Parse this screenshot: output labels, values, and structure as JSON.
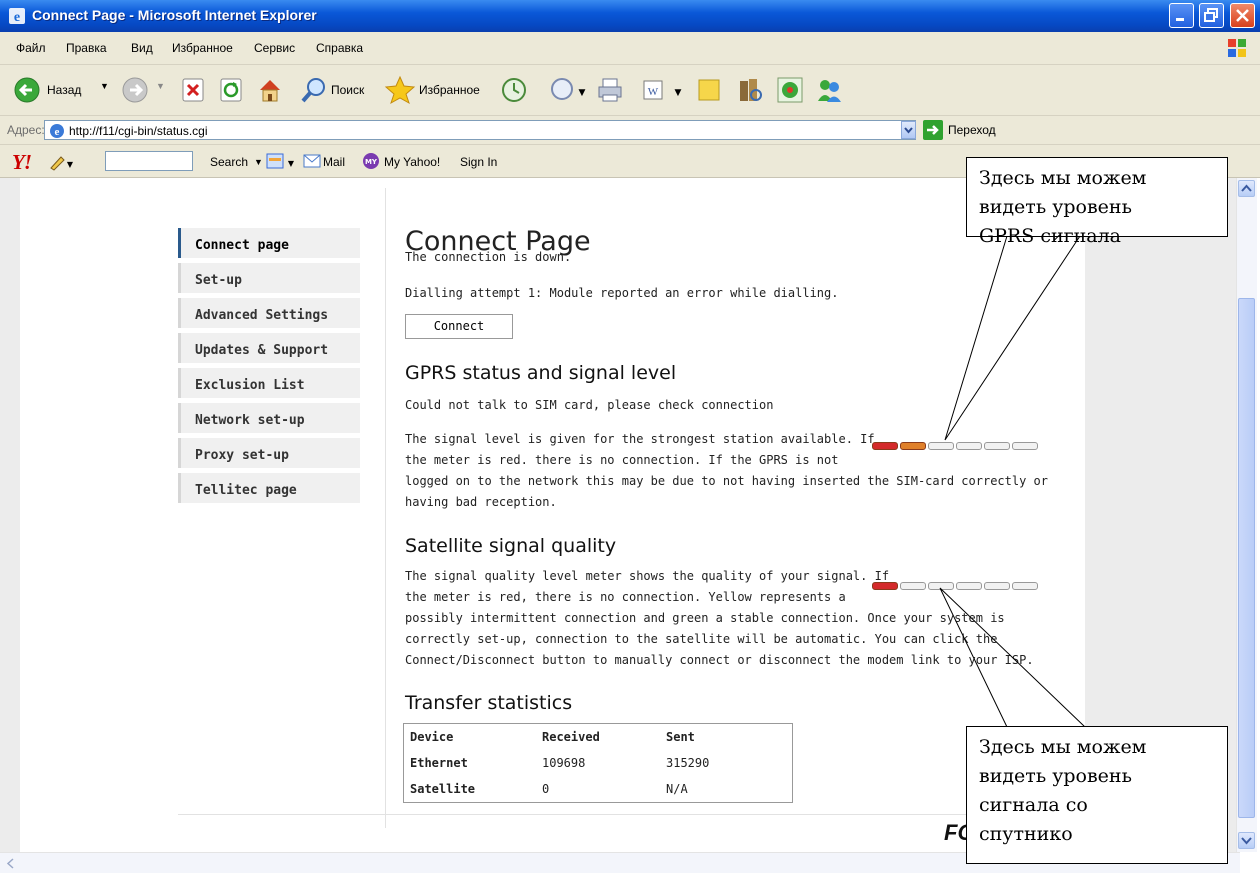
{
  "window": {
    "title": "Connect Page - Microsoft Internet Explorer"
  },
  "menu": [
    "Файл",
    "Правка",
    "Вид",
    "Избранное",
    "Сервис",
    "Справка"
  ],
  "toolbar": {
    "back_label": "Назад",
    "search_label": "Поиск",
    "favorites_label": "Избранное"
  },
  "address": {
    "label": "Адрес:",
    "url": "http://f11/cgi-bin/status.cgi",
    "go_label": "Переход"
  },
  "yahoo": {
    "search_label": "Search",
    "mail_label": "Mail",
    "myyahoo_label": "My Yahoo!",
    "signin_label": "Sign In"
  },
  "nav": [
    "Connect page",
    "Set-up",
    "Advanced Settings",
    "Updates & Support",
    "Exclusion List",
    "Network set-up",
    "Proxy set-up",
    "Tellitec page"
  ],
  "page": {
    "title": "Connect Page",
    "conn_status": "The connection is down.",
    "dial_status": "Dialling attempt 1: Module reported an error while dialling.",
    "connect_button": "Connect",
    "gprs": {
      "heading": "GPRS status and signal level",
      "line1": "Could not talk to SIM card, please check connection",
      "p1": "The signal level is given for the strongest station available. If",
      "p2": "the meter is red. there is no connection. If the GPRS is not",
      "p3": "logged on to the network this may be due to not having inserted the SIM-card correctly or",
      "p4": "having bad reception.",
      "signal_level": 2,
      "signal_total": 6
    },
    "satellite": {
      "heading": "Satellite signal quality",
      "p1": "The signal quality level meter shows the quality of your signal. If",
      "p2": "the meter is red, there is no connection. Yellow represents a",
      "p3": "possibly intermittent connection and green a stable connection. Once your system is",
      "p4": "correctly set-up, connection to the satellite will be automatic. You can click the",
      "p5": "Connect/Disconnect button to manually connect or disconnect the modem link to your ISP.",
      "signal_level": 1,
      "signal_total": 6
    },
    "transfer": {
      "heading": "Transfer statistics",
      "columns": [
        "Device",
        "Received",
        "Sent"
      ],
      "rows": [
        [
          "Ethernet",
          "109698",
          "315290"
        ],
        [
          "Satellite",
          "0",
          "N/A"
        ]
      ]
    },
    "footer_brand": "FO"
  },
  "callouts": {
    "top": [
      "Здесь мы можем",
      "видеть уровень",
      "GPRS сигнала"
    ],
    "bottom": [
      "Здесь мы можем",
      "видеть уровень",
      "сигнала со",
      "спутнико"
    ]
  },
  "colors": {
    "meter_red": "#d42a2a",
    "meter_orange": "#e0802a",
    "meter_empty": "#f2f2f2",
    "nav_active_bar": "#2a5a8c"
  }
}
